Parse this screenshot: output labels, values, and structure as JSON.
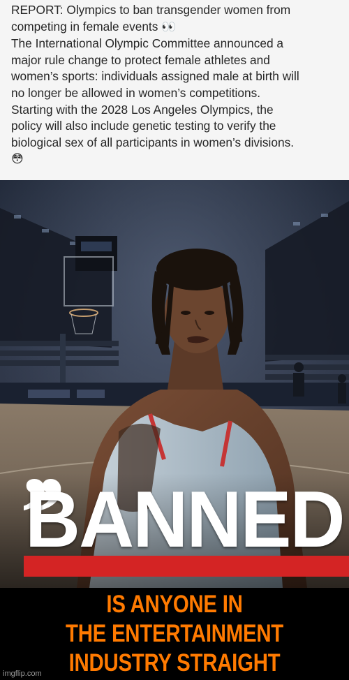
{
  "post": {
    "lines": [
      "REPORT: Olympics to ban transgender women from",
      "competing in female events",
      "The International Olympic Committee announced a",
      "major rule change to protect female athletes and",
      "women’s sports: individuals assigned male at birth will",
      "no longer be allowed in women’s competitions.",
      "Starting with the 2028 Los Angeles Olympics, the",
      "policy will also include genetic testing to verify the",
      "biological sex of all participants in women’s divisions."
    ],
    "eyes_emoji": "👀",
    "flushed_emoji": "😳"
  },
  "photo": {
    "quote_mark": ",,",
    "banned_label": "BANNED",
    "banner_color": "#d42424"
  },
  "meme_caption": {
    "lines": [
      "IS ANYONE IN",
      "THE ENTERTAINMENT",
      "INDUSTRY STRAIGHT"
    ],
    "color": "#ff7a00"
  },
  "watermark": "imgflip.com"
}
